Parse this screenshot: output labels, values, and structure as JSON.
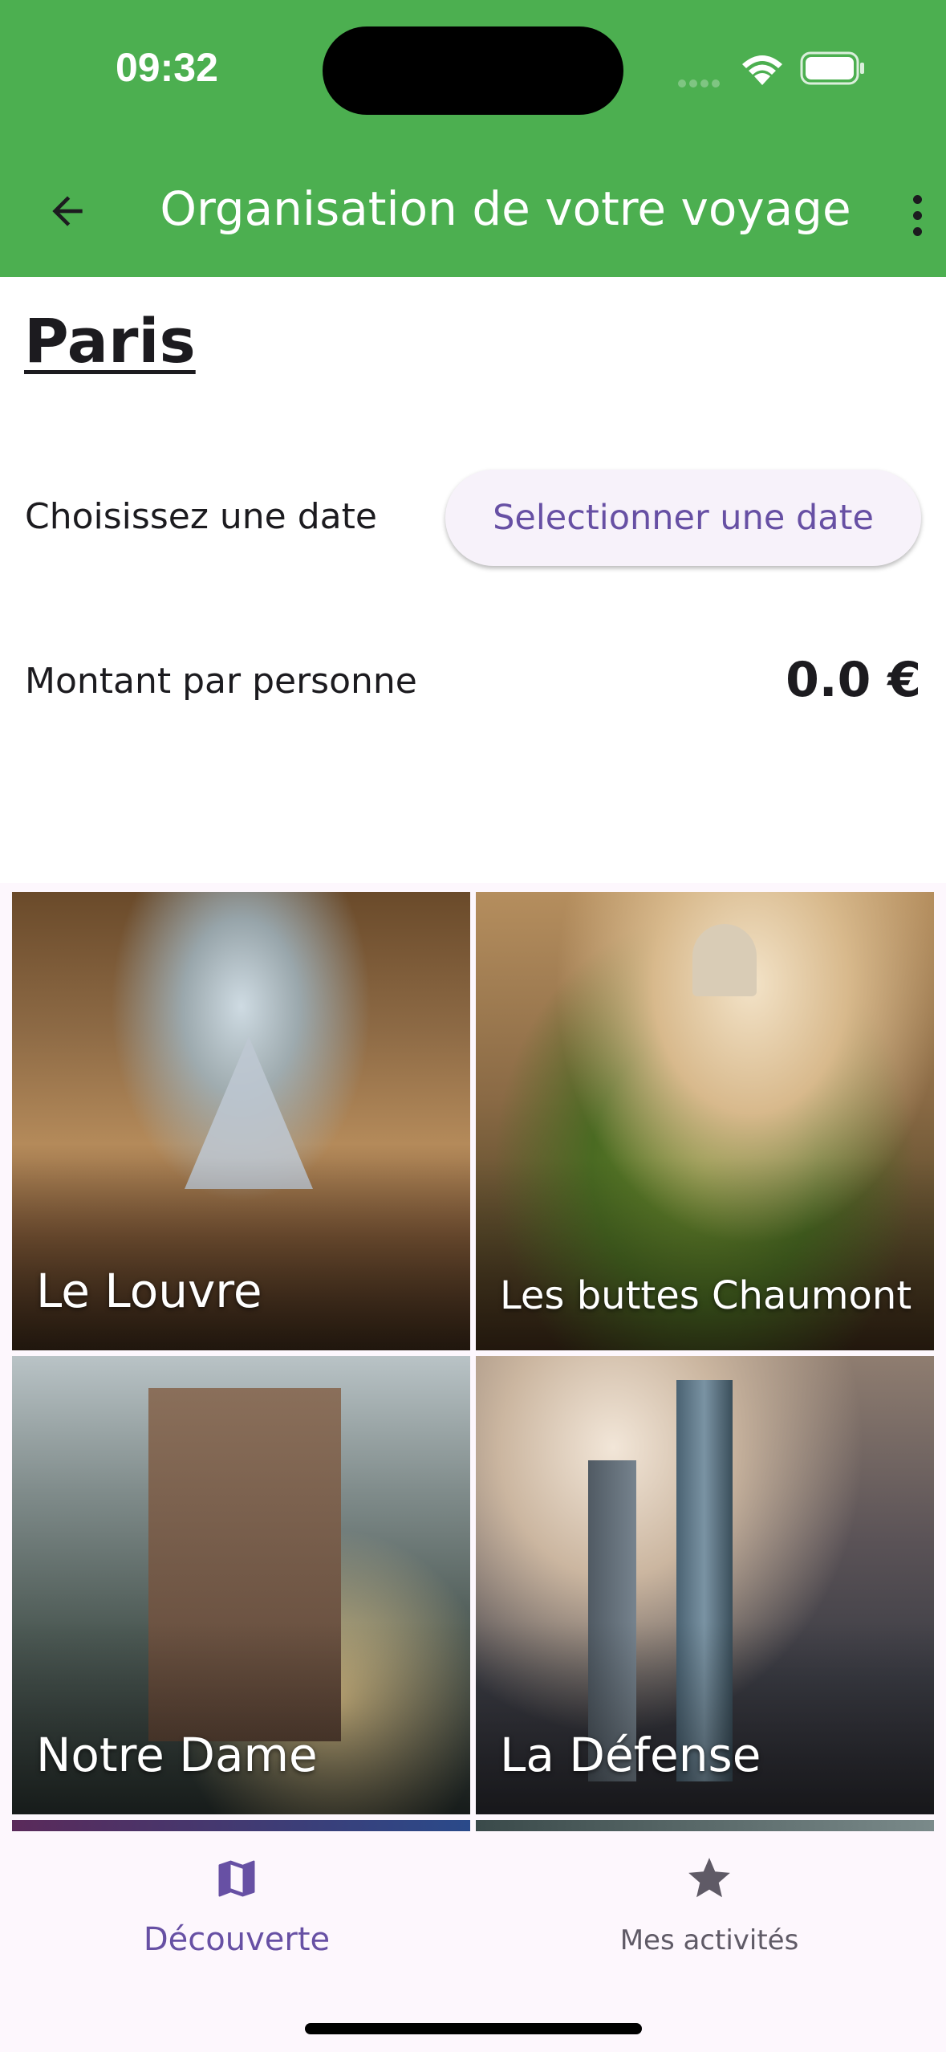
{
  "status_bar": {
    "time": "09:32"
  },
  "app_bar": {
    "title": "Organisation de votre voyage",
    "back_icon": "arrow-back-icon",
    "menu_icon": "more-vert-icon",
    "color": "#4caf50"
  },
  "city": "Paris",
  "date": {
    "label": "Choisissez une date",
    "button_label": "Selectionner une date"
  },
  "amount": {
    "label": "Montant par personne",
    "value": "0.0 €"
  },
  "places": [
    {
      "name": "Le Louvre"
    },
    {
      "name": "Les buttes Chaumont"
    },
    {
      "name": "Notre Dame"
    },
    {
      "name": "La Défense"
    }
  ],
  "bottom_nav": {
    "items": [
      {
        "label": "Découverte",
        "icon": "map-icon",
        "active": true
      },
      {
        "label": "Mes activités",
        "icon": "star-icon",
        "active": false
      }
    ],
    "active_color": "#6750a4"
  }
}
